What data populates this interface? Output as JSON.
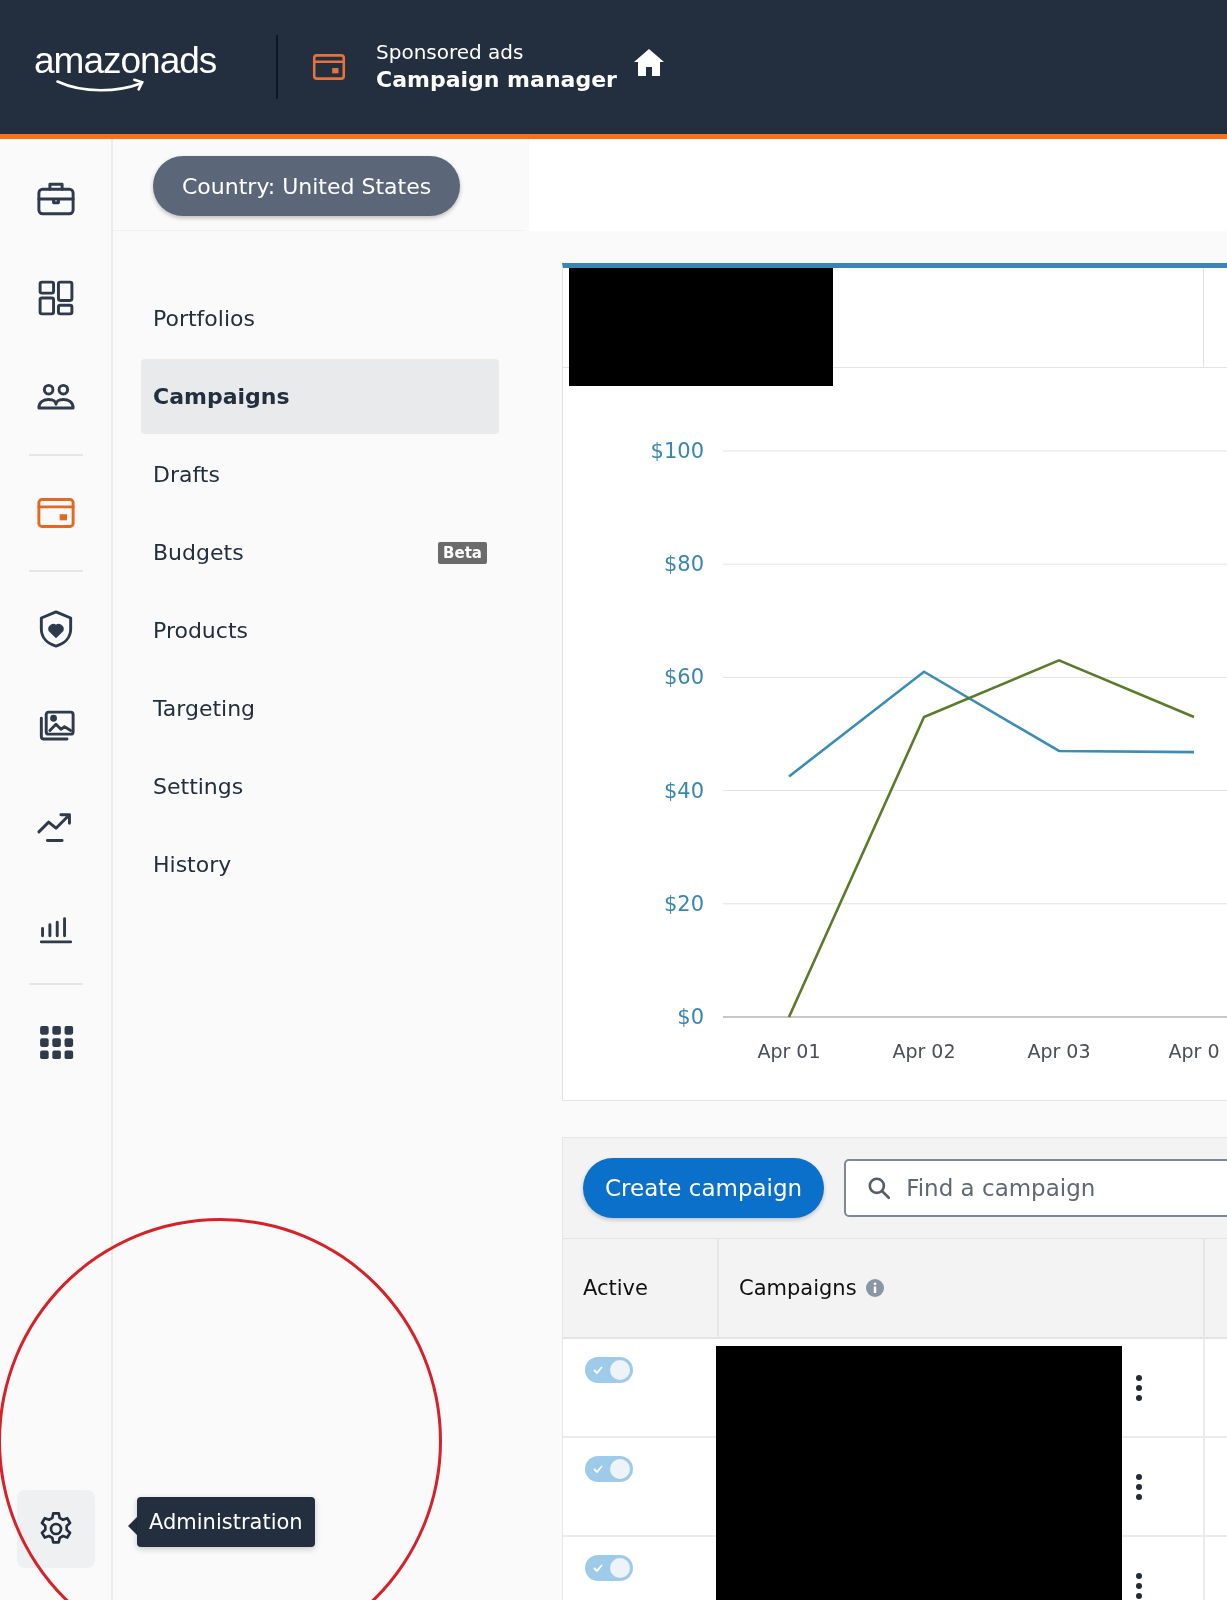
{
  "header": {
    "logo": "amazonads",
    "product_line": "Sponsored ads",
    "title": "Campaign manager"
  },
  "rail": [
    {
      "kind": "briefcase",
      "selected": false
    },
    {
      "kind": "dashboard",
      "selected": false
    },
    {
      "kind": "people",
      "selected": false
    },
    {
      "kind": "divider"
    },
    {
      "kind": "card",
      "selected": true
    },
    {
      "kind": "divider"
    },
    {
      "kind": "shield",
      "selected": false
    },
    {
      "kind": "images",
      "selected": false
    },
    {
      "kind": "trend",
      "selected": false
    },
    {
      "kind": "bars",
      "selected": false
    },
    {
      "kind": "divider"
    },
    {
      "kind": "grid",
      "selected": false
    }
  ],
  "rail_bottom": {
    "hovered": true,
    "tooltip": "Administration"
  },
  "country_pill": "Country: United States",
  "subnav": [
    {
      "label": "Portfolios",
      "selected": false
    },
    {
      "label": "Campaigns",
      "selected": true
    },
    {
      "label": "Drafts",
      "selected": false
    },
    {
      "label": "Budgets",
      "selected": false,
      "badge": "Beta"
    },
    {
      "label": "Products",
      "selected": false
    },
    {
      "label": "Targeting",
      "selected": false
    },
    {
      "label": "Settings",
      "selected": false
    },
    {
      "label": "History",
      "selected": false
    }
  ],
  "chart": {
    "chart_data": {
      "type": "line",
      "grid": true,
      "categories": [
        "Apr 01",
        "Apr 02",
        "Apr 03",
        "Apr 0"
      ],
      "yticks": [
        {
          "value": 0,
          "label": "$0"
        },
        {
          "value": 20,
          "label": "$20"
        },
        {
          "value": 40,
          "label": "$40"
        },
        {
          "value": 60,
          "label": "$60"
        },
        {
          "value": 80,
          "label": "$80"
        },
        {
          "value": 100,
          "label": "$100"
        }
      ],
      "ylim": [
        0,
        100
      ],
      "series": [
        {
          "color": "#3b8db5",
          "values": [
            42.5,
            61,
            47,
            46.8
          ]
        },
        {
          "color": "#5b7a2b",
          "values": [
            0,
            53,
            63,
            53
          ]
        }
      ]
    }
  },
  "toolbar": {
    "create_button": "Create campaign",
    "search": {
      "placeholder": "Find a campaign"
    }
  },
  "table": {
    "columns": [
      {
        "label": "Active"
      },
      {
        "label": "Campaigns",
        "info": true
      }
    ],
    "rows": [
      {
        "active": true
      },
      {
        "active": true
      },
      {
        "active": true
      }
    ]
  }
}
